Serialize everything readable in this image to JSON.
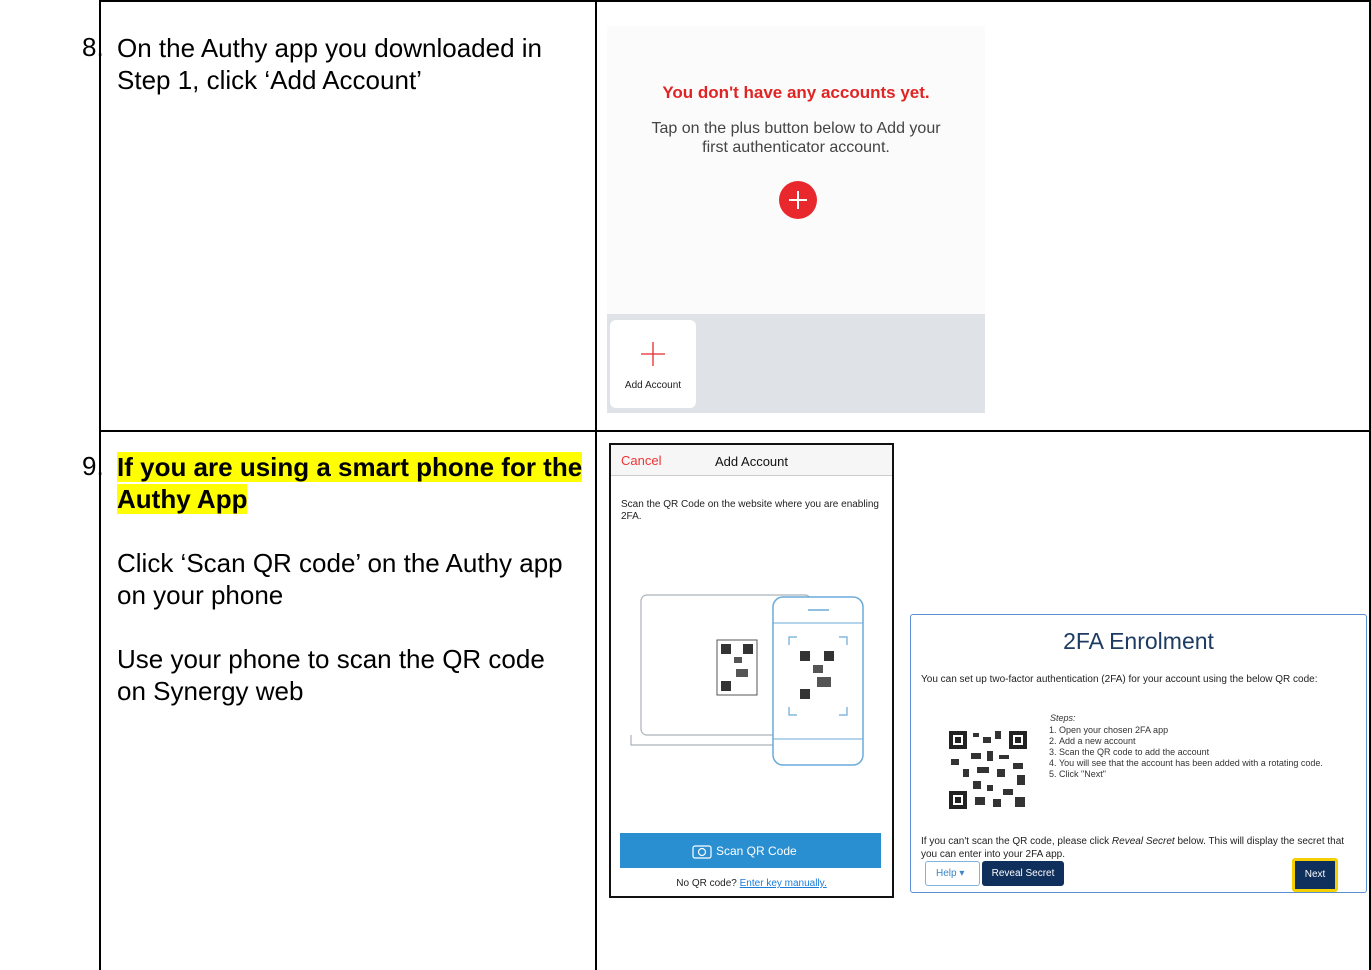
{
  "steps": [
    {
      "number": "8.",
      "text_lines": [
        "On the Authy app you downloaded in",
        "Step 1, click ‘Add Account’"
      ]
    },
    {
      "number": "9.",
      "highlight_lines": [
        "If you are using a smart phone for the",
        "Authy App"
      ],
      "para1_lines": [
        "Click ‘Scan QR code’ on the Authy app",
        "on your phone"
      ],
      "para2_lines": [
        "Use your phone to scan the QR code",
        "on Synergy web"
      ]
    }
  ],
  "authy_home": {
    "title": "You don't have any accounts yet.",
    "subtitle_lines": [
      "Tap on the plus button below to Add your",
      "first authenticator account."
    ],
    "add_account_label": "Add Account",
    "accent": "#e8282d"
  },
  "add_account_screen": {
    "cancel": "Cancel",
    "title": "Add Account",
    "description": "Scan the QR Code on the website where you are enabling 2FA.",
    "scan_button": "Scan QR Code",
    "no_qr_text": "No QR code?",
    "enter_key_link": "Enter key manually.",
    "button_color": "#2a8fd1"
  },
  "enrolment": {
    "title": "2FA Enrolment",
    "intro": "You can set up two-factor authentication (2FA) for your account using the below QR code:",
    "steps_label": "Steps:",
    "steps": [
      "Open your chosen 2FA app",
      "Add a new account",
      "Scan the QR code to add the account",
      "You will see that the account has been added with a rotating code.",
      "Click \"Next\""
    ],
    "reveal_note_before": "If you can't scan the QR code, please click ",
    "reveal_note_em": "Reveal Secret",
    "reveal_note_after": " below. This will display the secret that you can enter into your 2FA app.",
    "help_button": "Help ▾",
    "reveal_button": "Reveal Secret",
    "next_button": "Next",
    "primary_color": "#0f2f5c",
    "focus_color": "#f5d000"
  }
}
